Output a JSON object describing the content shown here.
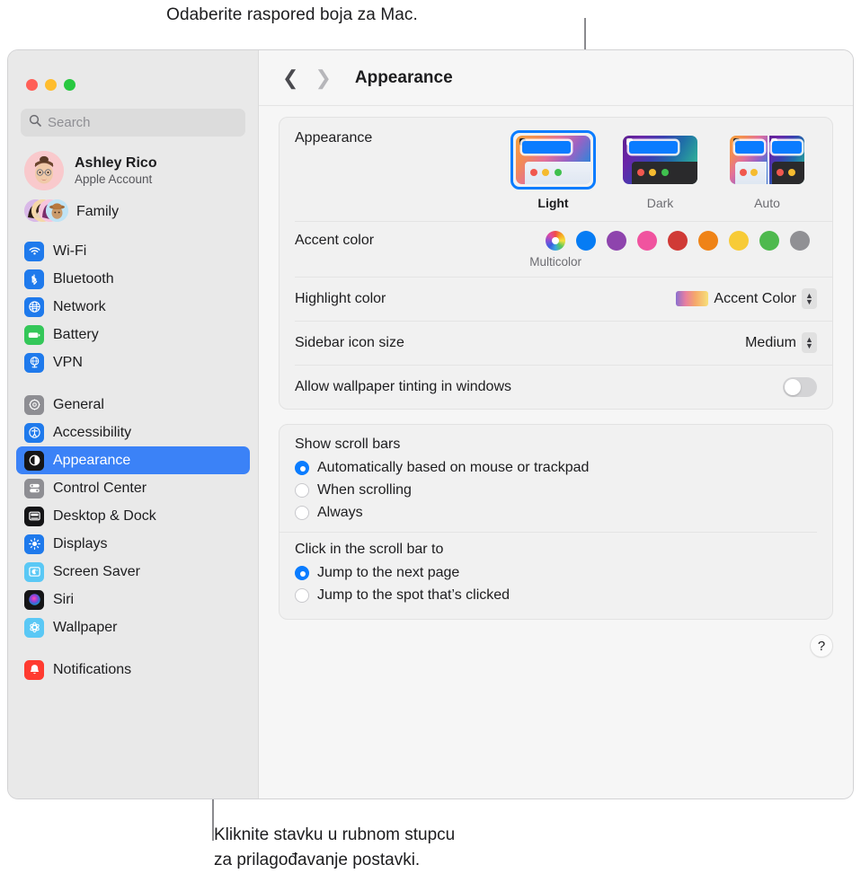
{
  "annotations": {
    "top": "Odaberite raspored boja za Mac.",
    "bottom_line1": "Kliknite stavku u rubnom stupcu",
    "bottom_line2": "za prilagođavanje postavki."
  },
  "window": {
    "traffic_lights": [
      "close",
      "minimize",
      "zoom"
    ]
  },
  "sidebar": {
    "search": {
      "placeholder": "Search",
      "value": ""
    },
    "account": {
      "name": "Ashley Rico",
      "subtitle": "Apple Account"
    },
    "family": {
      "label": "Family"
    },
    "groups": [
      {
        "items": [
          {
            "label": "Wi-Fi",
            "icon": "wifi-icon",
            "color": "#1f7aec",
            "selected": false
          },
          {
            "label": "Bluetooth",
            "icon": "bluetooth-icon",
            "color": "#1f7aec",
            "selected": false
          },
          {
            "label": "Network",
            "icon": "globe-icon",
            "color": "#1f7aec",
            "selected": false
          },
          {
            "label": "Battery",
            "icon": "battery-icon",
            "color": "#34c759",
            "selected": false
          },
          {
            "label": "VPN",
            "icon": "vpn-icon",
            "color": "#1f7aec",
            "selected": false
          }
        ]
      },
      {
        "items": [
          {
            "label": "General",
            "icon": "gear-icon",
            "color": "#8e8e93",
            "selected": false
          },
          {
            "label": "Accessibility",
            "icon": "accessibility-icon",
            "color": "#1f7aec",
            "selected": false
          },
          {
            "label": "Appearance",
            "icon": "appearance-icon",
            "color": "#1d1d1f",
            "selected": true
          },
          {
            "label": "Control Center",
            "icon": "control-center-icon",
            "color": "#8e8e93",
            "selected": false
          },
          {
            "label": "Desktop & Dock",
            "icon": "desktop-dock-icon",
            "color": "#1d1d1f",
            "selected": false
          },
          {
            "label": "Displays",
            "icon": "displays-icon",
            "color": "#1f7aec",
            "selected": false
          },
          {
            "label": "Screen Saver",
            "icon": "screen-saver-icon",
            "color": "#5ac8f5",
            "selected": false
          },
          {
            "label": "Siri",
            "icon": "siri-icon",
            "color": "#1d1d1f",
            "selected": false
          },
          {
            "label": "Wallpaper",
            "icon": "wallpaper-icon",
            "color": "#5ac8f5",
            "selected": false
          }
        ]
      },
      {
        "items": [
          {
            "label": "Notifications",
            "icon": "notifications-icon",
            "color": "#ff3b30",
            "selected": false
          }
        ]
      }
    ]
  },
  "toolbar": {
    "back_icon": "chevron-left-icon",
    "forward_icon": "chevron-right-icon",
    "title": "Appearance"
  },
  "main": {
    "appearance": {
      "label": "Appearance",
      "options": [
        {
          "name": "Light",
          "selected": true
        },
        {
          "name": "Dark",
          "selected": false
        },
        {
          "name": "Auto",
          "selected": false
        }
      ]
    },
    "accent_color": {
      "label": "Accent color",
      "caption": "Multicolor",
      "swatches": [
        {
          "name": "Multicolor",
          "color": "multicolor",
          "selected": true
        },
        {
          "name": "Blue",
          "color": "#067cf4"
        },
        {
          "name": "Purple",
          "color": "#8e44ad"
        },
        {
          "name": "Pink",
          "color": "#f0539f"
        },
        {
          "name": "Red",
          "color": "#d03a36"
        },
        {
          "name": "Orange",
          "color": "#ef8317"
        },
        {
          "name": "Yellow",
          "color": "#f7cb37"
        },
        {
          "name": "Green",
          "color": "#4eb94e"
        },
        {
          "name": "Graphite",
          "color": "#909094"
        }
      ]
    },
    "highlight_color": {
      "label": "Highlight color",
      "value": "Accent Color",
      "chip": "gradient-swatch"
    },
    "sidebar_icon_size": {
      "label": "Sidebar icon size",
      "value": "Medium"
    },
    "wallpaper_tinting": {
      "label": "Allow wallpaper tinting in windows",
      "enabled": false
    },
    "scroll_bars": {
      "title": "Show scroll bars",
      "options": [
        {
          "label": "Automatically based on mouse or trackpad",
          "selected": true
        },
        {
          "label": "When scrolling",
          "selected": false
        },
        {
          "label": "Always",
          "selected": false
        }
      ]
    },
    "scroll_click": {
      "title": "Click in the scroll bar to",
      "options": [
        {
          "label": "Jump to the next page",
          "selected": true
        },
        {
          "label": "Jump to the spot that’s clicked",
          "selected": false
        }
      ]
    },
    "help": {
      "label": "?"
    }
  }
}
